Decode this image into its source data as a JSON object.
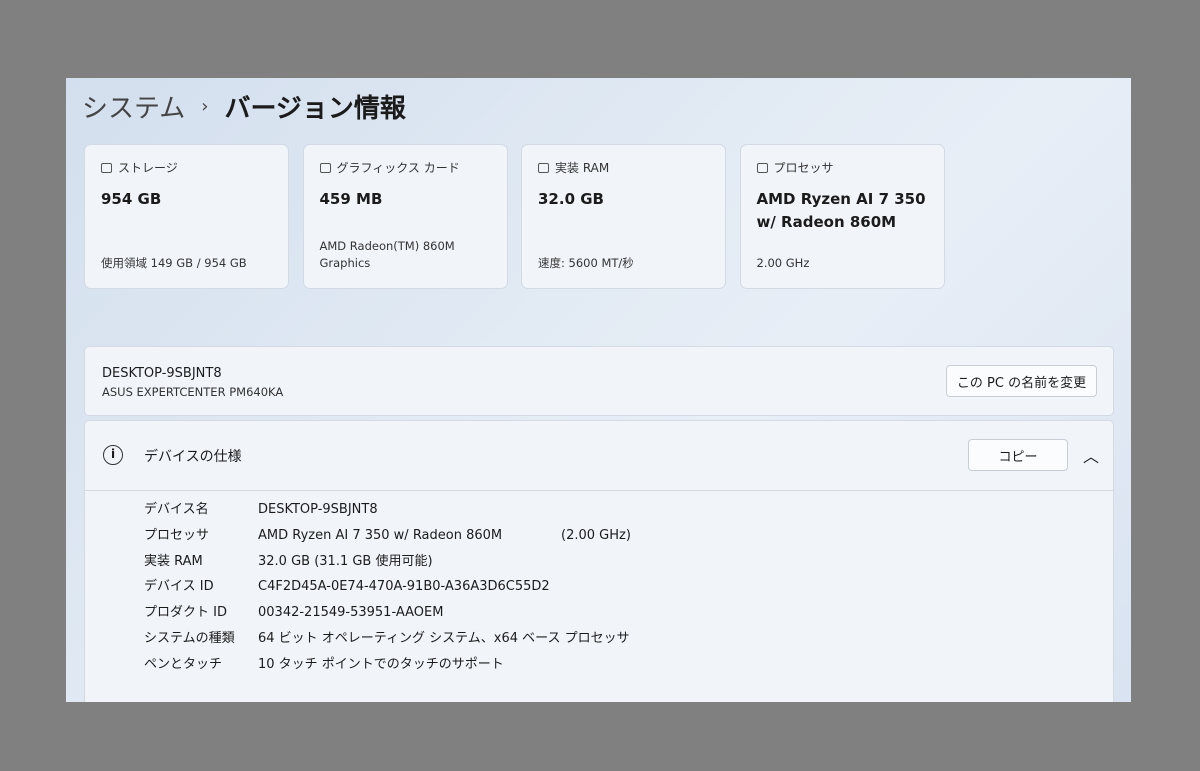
{
  "breadcrumb": {
    "parent": "システム",
    "separator": "›",
    "current": "バージョン情報"
  },
  "cards": [
    {
      "title": "ストレージ",
      "icon": "storage-icon",
      "value": "954 GB",
      "sub": "使用領域 149 GB / 954 GB"
    },
    {
      "title": "グラフィックス カード",
      "icon": "graphics-card-icon",
      "value": "459 MB",
      "sub": "AMD Radeon(TM) 860M Graphics"
    },
    {
      "title": "実装 RAM",
      "icon": "ram-icon",
      "value": "32.0 GB",
      "sub": "速度: 5600 MT/秒"
    },
    {
      "title": "プロセッサ",
      "icon": "processor-icon",
      "value": "AMD Ryzen AI 7 350 w/ Radeon 860M",
      "sub": "2.00 GHz"
    }
  ],
  "pc": {
    "name": "DESKTOP-9SBJNT8",
    "model": "ASUS EXPERTCENTER PM640KA",
    "rename_label": "この PC の名前を変更"
  },
  "specs": {
    "title": "デバイスの仕様",
    "copy_label": "コピー",
    "rows": [
      {
        "k": "デバイス名",
        "v": "DESKTOP-9SBJNT8",
        "extra": ""
      },
      {
        "k": "プロセッサ",
        "v": "AMD Ryzen AI 7 350 w/ Radeon 860M",
        "extra": "(2.00 GHz)"
      },
      {
        "k": "実装 RAM",
        "v": "32.0 GB (31.1 GB 使用可能)",
        "extra": ""
      },
      {
        "k": "デバイス ID",
        "v": "C4F2D45A-0E74-470A-91B0-A36A3D6C55D2",
        "extra": ""
      },
      {
        "k": "プロダクト ID",
        "v": "00342-21549-53951-AAOEM",
        "extra": ""
      },
      {
        "k": "システムの種類",
        "v": "64 ビット オペレーティング システム、x64 ベース プロセッサ",
        "extra": ""
      },
      {
        "k": "ペンとタッチ",
        "v": "10 タッチ ポイントでのタッチのサポート",
        "extra": ""
      }
    ]
  }
}
